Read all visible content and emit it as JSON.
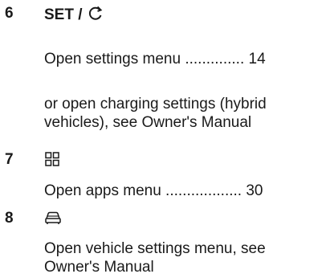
{
  "items": [
    {
      "number": "6",
      "heading_text": "SET /",
      "heading_icon": "power-cycle-icon",
      "entries": [
        "Open settings menu .............. 14",
        "or open charging settings (hybrid vehicles), see Owner's Manual"
      ]
    },
    {
      "number": "7",
      "heading_icon": "apps-grid-icon",
      "entries": [
        "Open apps menu .................. 30"
      ]
    },
    {
      "number": "8",
      "heading_icon": "car-icon",
      "entries": [
        "Open vehicle settings menu, see Owner's Manual"
      ]
    }
  ]
}
